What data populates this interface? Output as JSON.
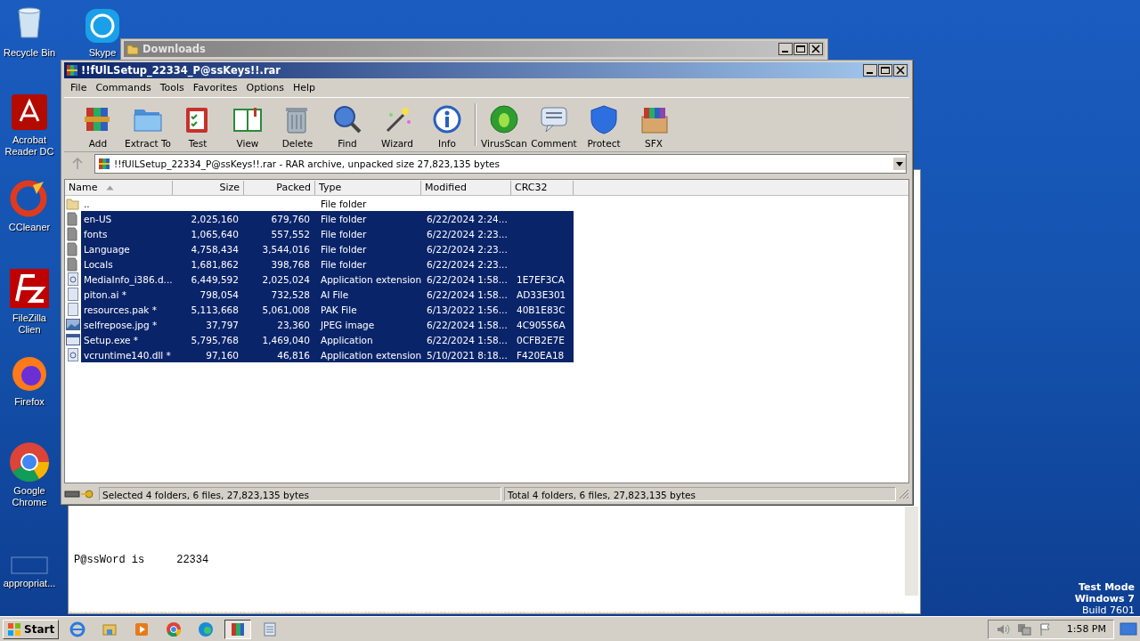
{
  "desktop_icons": [
    {
      "label": "Recycle Bin"
    },
    {
      "label": "Skype"
    },
    {
      "label": "Acrobat Reader DC"
    },
    {
      "label": "CCleaner"
    },
    {
      "label": "FileZilla Clien"
    },
    {
      "label": "Firefox"
    },
    {
      "label": "Google Chrome"
    },
    {
      "label": "appropriat..."
    }
  ],
  "notepad": {
    "lines": [
      "P@ssWord is     22334"
    ]
  },
  "downloads_window": {
    "title": "Downloads"
  },
  "winrar": {
    "title": "!!fUlLSetup_22334_P@ssKeys!!.rar",
    "menu": [
      "File",
      "Commands",
      "Tools",
      "Favorites",
      "Options",
      "Help"
    ],
    "toolbar": [
      {
        "label": "Add"
      },
      {
        "label": "Extract To"
      },
      {
        "label": "Test"
      },
      {
        "label": "View"
      },
      {
        "label": "Delete"
      },
      {
        "label": "Find"
      },
      {
        "label": "Wizard"
      },
      {
        "label": "Info"
      },
      {
        "label": "VirusScan"
      },
      {
        "label": "Comment"
      },
      {
        "label": "Protect"
      },
      {
        "label": "SFX"
      }
    ],
    "address": "!!fUlLSetup_22334_P@ssKeys!!.rar - RAR archive, unpacked size 27,823,135 bytes",
    "columns": [
      {
        "label": "Name",
        "sorted": true
      },
      {
        "label": "Size",
        "sorted": false
      },
      {
        "label": "Packed",
        "sorted": false
      },
      {
        "label": "Type",
        "sorted": false
      },
      {
        "label": "Modified",
        "sorted": false
      },
      {
        "label": "CRC32",
        "sorted": false
      }
    ],
    "rows": [
      {
        "kind": "up",
        "selected": false,
        "cells": [
          "..",
          "",
          "",
          "File folder",
          "",
          ""
        ]
      },
      {
        "kind": "folder",
        "selected": true,
        "cells": [
          "en-US",
          "2,025,160",
          "679,760",
          "File folder",
          "6/22/2024 2:24...",
          ""
        ]
      },
      {
        "kind": "folder",
        "selected": true,
        "cells": [
          "fonts",
          "1,065,640",
          "557,552",
          "File folder",
          "6/22/2024 2:23...",
          ""
        ]
      },
      {
        "kind": "folder",
        "selected": true,
        "cells": [
          "Language",
          "4,758,434",
          "3,544,016",
          "File folder",
          "6/22/2024 2:23...",
          ""
        ]
      },
      {
        "kind": "folder",
        "selected": true,
        "cells": [
          "Locals",
          "1,681,862",
          "398,768",
          "File folder",
          "6/22/2024 2:23...",
          ""
        ]
      },
      {
        "kind": "dll",
        "selected": true,
        "cells": [
          "MediaInfo_i386.d...",
          "6,449,592",
          "2,025,024",
          "Application extension",
          "6/22/2024 1:58...",
          "1E7EF3CA"
        ]
      },
      {
        "kind": "file",
        "selected": true,
        "cells": [
          "piton.ai *",
          "798,054",
          "732,528",
          "AI File",
          "6/22/2024 1:58...",
          "AD33E301"
        ]
      },
      {
        "kind": "file",
        "selected": true,
        "cells": [
          "resources.pak *",
          "5,113,668",
          "5,061,008",
          "PAK File",
          "6/13/2022 1:56...",
          "40B1E83C"
        ]
      },
      {
        "kind": "image",
        "selected": true,
        "cells": [
          "selfrepose.jpg *",
          "37,797",
          "23,360",
          "JPEG image",
          "6/22/2024 1:58...",
          "4C90556A"
        ]
      },
      {
        "kind": "exe",
        "selected": true,
        "cells": [
          "Setup.exe *",
          "5,795,768",
          "1,469,040",
          "Application",
          "6/22/2024 1:58...",
          "0CFB2E7E"
        ]
      },
      {
        "kind": "dll",
        "selected": true,
        "cells": [
          "vcruntime140.dll *",
          "97,160",
          "46,816",
          "Application extension",
          "5/10/2021 8:18...",
          "F420EA18"
        ]
      }
    ],
    "status": [
      "Selected 4 folders, 6 files, 27,823,135 bytes",
      "Total 4 folders, 6 files, 27,823,135 bytes"
    ]
  },
  "os_notice": [
    "Test Mode",
    "Windows 7",
    "Build 7601"
  ],
  "taskbar": {
    "start": "Start",
    "apps": [
      {
        "active": false
      },
      {
        "active": false
      },
      {
        "active": false
      },
      {
        "active": false
      },
      {
        "active": false
      },
      {
        "active": true
      },
      {
        "active": false
      }
    ],
    "clock": "1:58 PM"
  }
}
